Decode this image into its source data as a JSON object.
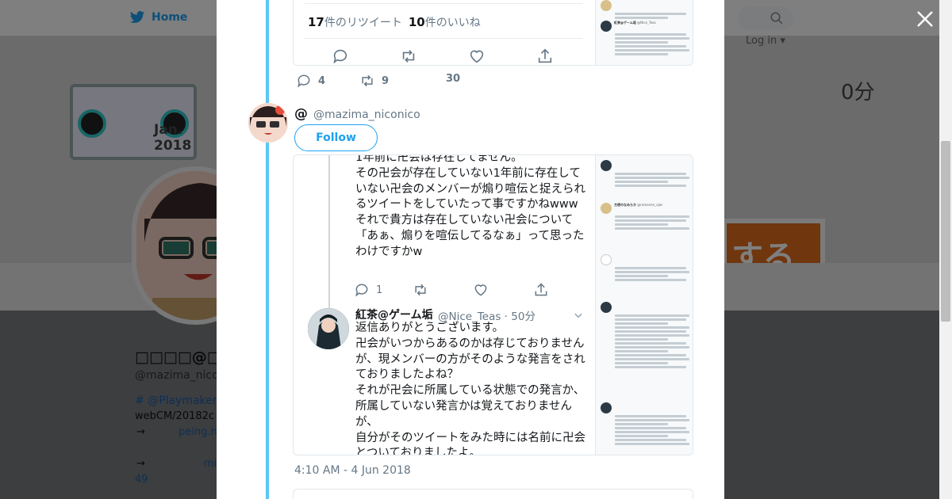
{
  "nav": {
    "home_label": "Home",
    "login_label": "Log in"
  },
  "background_profile": {
    "banner_date": "Jan. 2018",
    "banner_time": "0分",
    "banner_button_text": "する",
    "name": "□□□□@□□□",
    "handle": "@mazima_nico",
    "bio_tag": "# @Playmaker",
    "bio_line": "webCM/20182c",
    "link1_arrow": "→",
    "link1_text": "peing.n",
    "link2_arrow": "→",
    "link2_text": "mi",
    "number": "49"
  },
  "modal": {
    "top_card": {
      "retweets_count": "17",
      "retweets_label": "件のリツイート",
      "likes_count": "10",
      "likes_label": "件のいいね"
    },
    "stats": {
      "replies": "4",
      "retweets": "9",
      "likes": "30"
    },
    "author": {
      "at": "@",
      "handle": "@mazima_niconico",
      "follow_label": "Follow"
    },
    "embedded_card": {
      "tweet1_text": "1年前に卍会は存在してません。\nその卍会が存在していない1年前に存在していない卍会のメンバーが煽り喧伝と捉えられるツイートをしていたって事ですかねwww\nそれで貴方は存在していない卍会について「あぁ、煽りを喧伝してるなぁ」って思ったわけですかw",
      "tweet1_reply_count": "1",
      "reply_name": "紅茶@ゲーム垢",
      "reply_handle": "@Nice_Teas · 50分",
      "tweet2_text": "返信ありがとうございます。\n卍会がいつからあるのかは存じておりませんが、現メンバーの方がそのような発言をされておりましたよね？\nそれが卍会に所属している状態での発言か、所属していない発言かは覚えておりませんが、\n自分がそのツイートをみた時には名前に卍会とついておりましたよ。"
    },
    "thumbnails": {
      "name_a": "紅茶@ゲーム垢",
      "handle_a": "@Nice_Teas",
      "name_b": "方便のなめらか",
      "handle_b": "@ramenen_ojas"
    },
    "timestamp": "4:10 AM - 4 Jun 2018"
  },
  "colors": {
    "accent": "#1da1f2",
    "thread": "#5ac7f5",
    "banner_orange": "#e16c1c"
  }
}
